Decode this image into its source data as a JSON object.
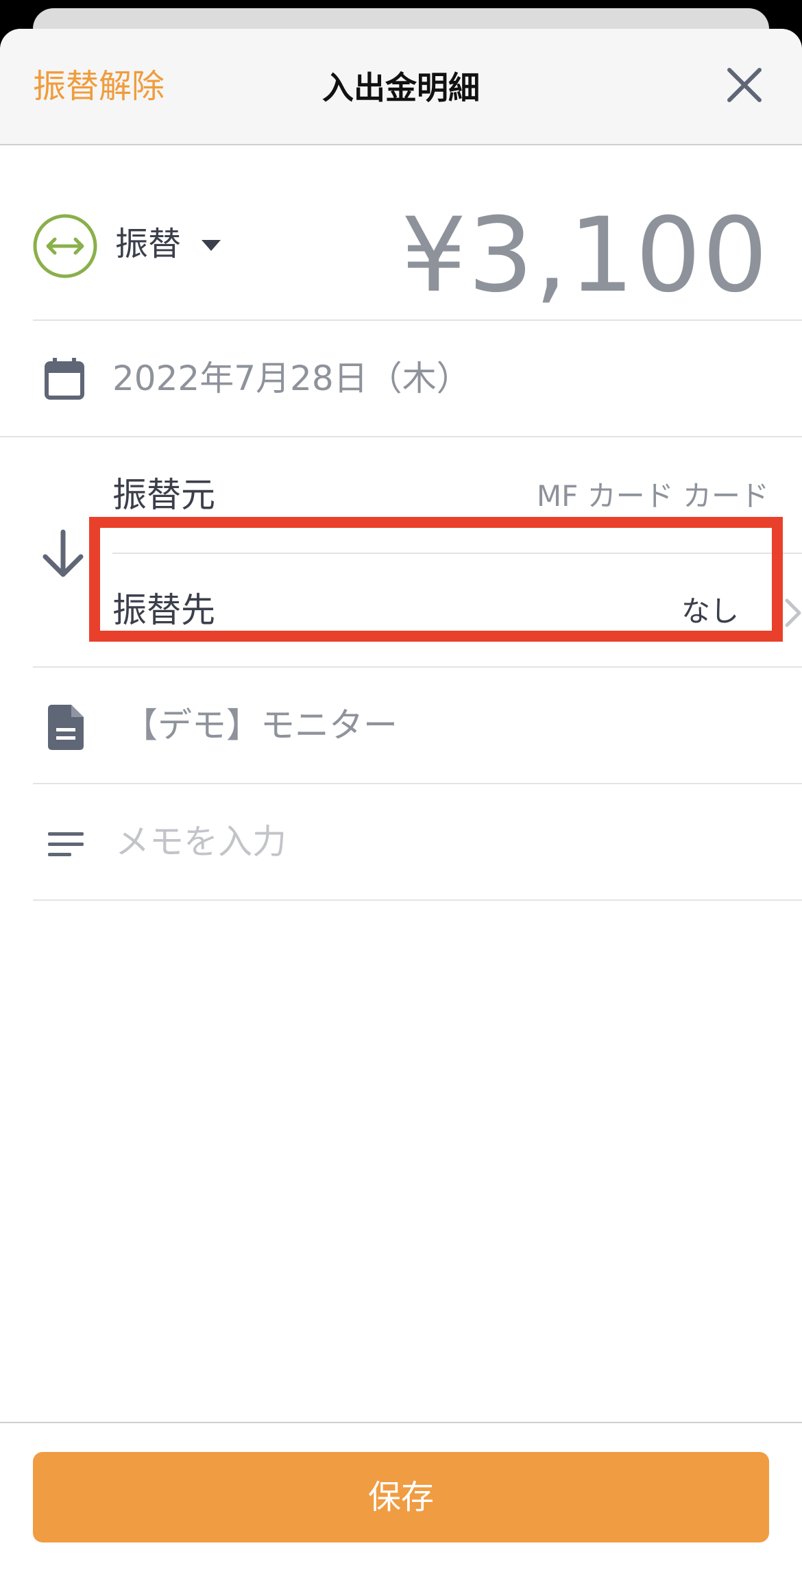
{
  "header": {
    "unlink_label": "振替解除",
    "title": "入出金明細"
  },
  "type": {
    "label": "振替",
    "amount": "¥3,100"
  },
  "date": {
    "text": "2022年7月28日（木）"
  },
  "transfer": {
    "source_label": "振替元",
    "source_value": "MF カード カード",
    "destination_label": "振替先",
    "destination_value": "なし"
  },
  "content": {
    "text": "【デモ】モニター"
  },
  "memo": {
    "placeholder": "メモを入力"
  },
  "footer": {
    "save_label": "保存"
  },
  "icons": {
    "type": "transfer-arrows-icon",
    "date": "calendar-icon",
    "transfer_direction": "arrow-down-icon",
    "content": "document-icon",
    "memo": "memo-lines-icon",
    "close": "close-icon"
  },
  "colors": {
    "accent": "#f09c42",
    "transfer_green": "#8ab04a",
    "highlight": "#e8402a",
    "icon_slate": "#5f6676"
  }
}
